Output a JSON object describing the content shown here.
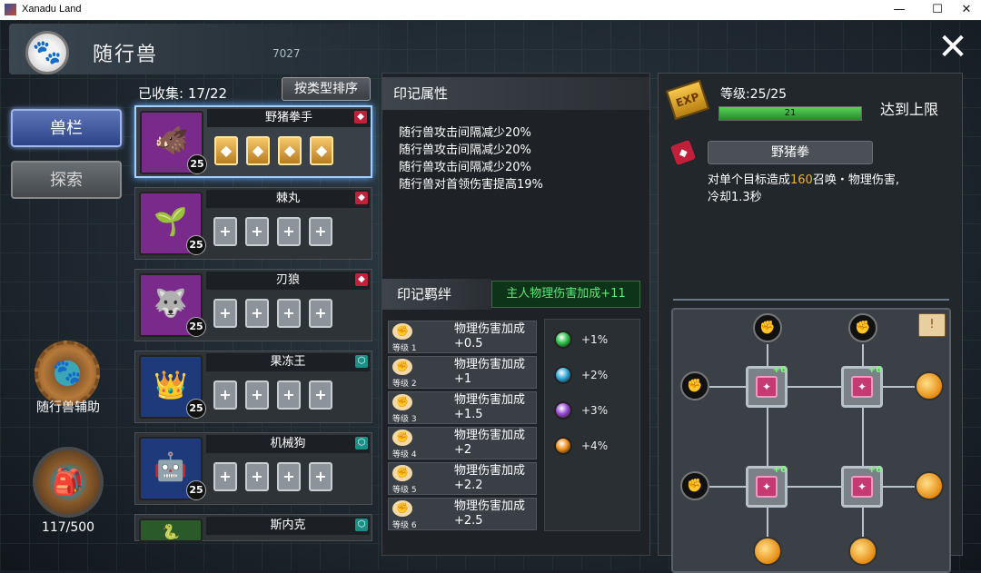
{
  "window": {
    "title": "Xanadu Land",
    "minimize": "—",
    "maximize": "☐",
    "close": "✕"
  },
  "header": {
    "title": "随行兽",
    "coins": "7027",
    "close_glyph": "✕"
  },
  "tabs": {
    "beast_slot": "兽栏",
    "explore": "探索"
  },
  "assist": {
    "label": "随行兽辅助"
  },
  "storage": {
    "count": "117/500"
  },
  "list": {
    "collected": "已收集: 17/22",
    "sort_label": "按类型排序",
    "pets": [
      {
        "name": "野猪拳手",
        "level": "25",
        "tag": "red",
        "portrait_color": "#7a2a8a",
        "glyph": "🐗",
        "runes": [
          "◆",
          "◆",
          "◆",
          "◆"
        ],
        "rune_type": "gold"
      },
      {
        "name": "棘丸",
        "level": "25",
        "tag": "red",
        "portrait_color": "#7a2a8a",
        "glyph": "🌱",
        "runes": [
          "+",
          "+",
          "+",
          "+"
        ],
        "rune_type": "empty"
      },
      {
        "name": "刃狼",
        "level": "25",
        "tag": "red",
        "portrait_color": "#7a2a8a",
        "glyph": "🐺",
        "runes": [
          "+",
          "+",
          "+",
          "+"
        ],
        "rune_type": "empty"
      },
      {
        "name": "果冻王",
        "level": "25",
        "tag": "teal",
        "portrait_color": "#1e3a7a",
        "glyph": "👑",
        "runes": [
          "+",
          "+",
          "+",
          "+"
        ],
        "rune_type": "empty"
      },
      {
        "name": "机械狗",
        "level": "25",
        "tag": "teal",
        "portrait_color": "#1e3a7a",
        "glyph": "🤖",
        "runes": [
          "+",
          "+",
          "+",
          "+"
        ],
        "rune_type": "empty"
      },
      {
        "name": "斯内克",
        "level": "",
        "tag": "teal",
        "portrait_color": "#2a5a2a",
        "glyph": "🐍",
        "runes": [],
        "rune_type": "empty"
      }
    ]
  },
  "mark": {
    "title": "印记属性",
    "attributes": [
      "随行兽攻击间隔减少20%",
      "随行兽攻击间隔减少20%",
      "随行兽攻击间隔减少20%",
      "随行兽对首领伤害提高19%"
    ],
    "bond_title": "印记羁绊",
    "bond_bonus": "主人物理伤害加成+11",
    "bonds": [
      {
        "level": "等级 1",
        "text": "物理伤害加成+0.5"
      },
      {
        "level": "等级 2",
        "text": "物理伤害加成+1"
      },
      {
        "level": "等级 3",
        "text": "物理伤害加成+1.5"
      },
      {
        "level": "等级 4",
        "text": "物理伤害加成+2"
      },
      {
        "level": "等级 5",
        "text": "物理伤害加成+2.2"
      },
      {
        "level": "等级 6",
        "text": "物理伤害加成+2.5"
      }
    ],
    "gems": [
      {
        "color": "#2ec24a",
        "pct": "+1%"
      },
      {
        "color": "#2fa8d8",
        "pct": "+2%"
      },
      {
        "color": "#9b4ad8",
        "pct": "+3%"
      },
      {
        "color": "#f0901a",
        "pct": "+4%"
      }
    ]
  },
  "detail": {
    "exp_label": "EXP",
    "level_text": "等级:25/25",
    "exp_value": "21",
    "exp_fill_percent": 100,
    "max_text": "达到上限",
    "skill_name": "野猪拳",
    "skill_desc_a": "对单个目标造成",
    "skill_desc_num": "160",
    "skill_desc_b": "召唤・物理伤害,",
    "skill_desc_c": "冷却1.3秒",
    "node_level": "+6"
  }
}
